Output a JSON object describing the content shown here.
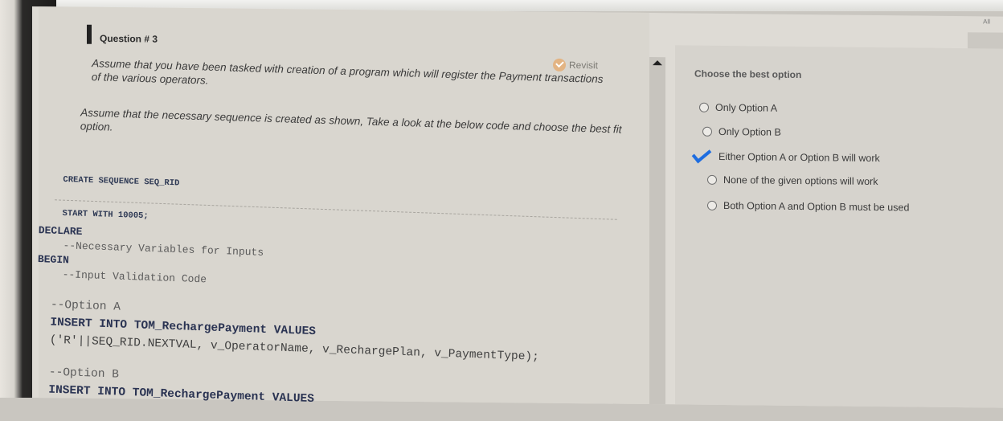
{
  "question": {
    "title": "Question # 3",
    "revisit_label": "Revisit",
    "paragraph1": "Assume that you have been tasked with creation of a program which will register the Payment transactions of the various operators.",
    "paragraph2": "Assume that the necessary sequence is created as shown, Take a look at the below code and choose the best fit option.",
    "sequence_code": [
      "CREATE SEQUENCE SEQ_RID",
      "START WITH 10005;"
    ],
    "code_lines": [
      "DECLARE",
      "    --Necessary Variables for Inputs",
      "BEGIN",
      "    --Input Validation Code",
      "",
      "  --Option A",
      "  INSERT INTO TOM_RechargePayment VALUES",
      "  ('R'||SEQ_RID.NEXTVAL, v_OperatorName, v_RechargePlan, v_PaymentType);",
      "",
      "  --Option B",
      "  INSERT INTO TOM_RechargePayment VALUES"
    ]
  },
  "answers": {
    "title": "Choose the best option",
    "options": [
      {
        "label": "Only Option A",
        "selected": false
      },
      {
        "label": "Only Option B",
        "selected": false
      },
      {
        "label": "Either Option A or Option B will work",
        "selected": true
      },
      {
        "label": "None of the given options will work",
        "selected": false
      },
      {
        "label": "Both Option A and Option B must be used",
        "selected": false
      }
    ]
  },
  "corner_label": "All",
  "colors": {
    "check_mark": "#1e6de0",
    "keyword": "#2a3352"
  }
}
